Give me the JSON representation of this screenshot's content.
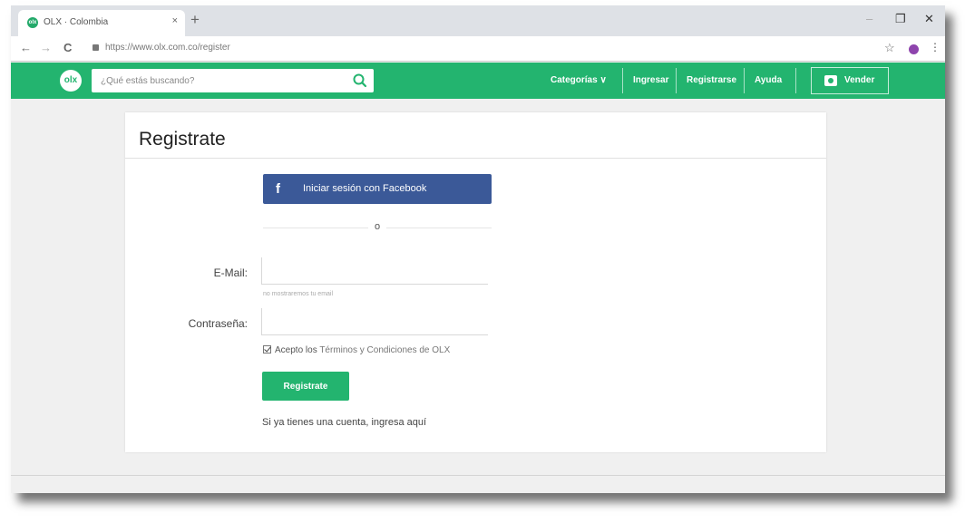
{
  "browser": {
    "tab_title": "OLX · Colombia",
    "tab_favicon": "olx",
    "tab_close": "×",
    "new_tab": "+",
    "url": "https://www.olx.com.co/register",
    "nav_icons": {
      "back": "←",
      "forward": "→",
      "reload": "C"
    },
    "window_controls": {
      "minimize": "–",
      "restore": "❐",
      "close": "✕"
    },
    "star": "☆",
    "menu": "⋮"
  },
  "header": {
    "logo": "olx",
    "search_placeholder": "¿Qué estás buscando?",
    "nav": {
      "categorias": "Categorías ∨",
      "ingresar": "Ingresar",
      "registrarse": "Registrarse",
      "ayuda": "Ayuda",
      "vender": "Vender"
    }
  },
  "form": {
    "title": "Registrate",
    "facebook_icon": "f",
    "facebook_label": "Iniciar sesión con Facebook",
    "or_text": "o",
    "email_label": "E-Mail:",
    "email_value": "",
    "email_hint": "no mostraremos tu email",
    "password_label": "Contraseña:",
    "password_value": "",
    "terms_prefix": "Acepto los",
    "terms_link": "Términos y Condiciones de OLX",
    "terms_checked": true,
    "register_button": "Registrate",
    "login_prefix": "Si ya tienes una cuenta,",
    "login_link": "ingresa aquí"
  },
  "colors": {
    "brand": "#23b46f",
    "facebook": "#3b5998"
  }
}
